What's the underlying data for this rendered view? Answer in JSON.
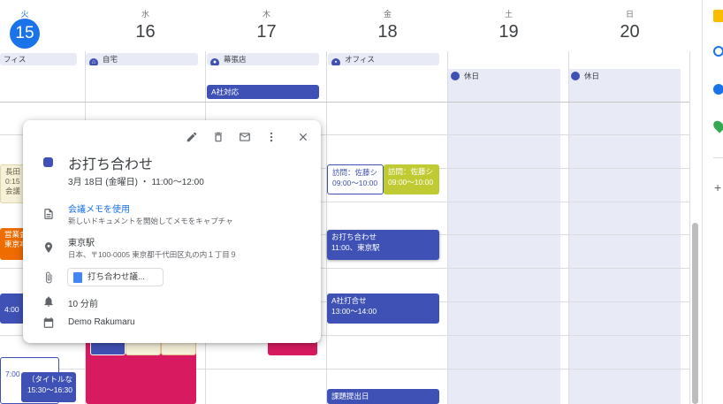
{
  "days": [
    {
      "dow": "火",
      "num": "15",
      "today": true
    },
    {
      "dow": "水",
      "num": "16"
    },
    {
      "dow": "木",
      "num": "17"
    },
    {
      "dow": "金",
      "num": "18"
    },
    {
      "dow": "土",
      "num": "19"
    },
    {
      "dow": "日",
      "num": "20"
    }
  ],
  "allday": {
    "tue": "フィス",
    "wed": "自宅",
    "thu": "幕張店",
    "fri": "オフィス",
    "thu_event": "A社対応",
    "sat": "休日",
    "sun": "休日"
  },
  "events": {
    "tue_a_line1": "長田",
    "tue_a_line2": "0:15",
    "tue_a_line3": "会議",
    "tue_b_line1": "営業会",
    "tue_b_line2": "東京本",
    "tue_c": "4:00",
    "tue_d": "7:00",
    "tue_e_line1": "（タイトルな",
    "tue_e_line2": "15:30〜16:30",
    "fri_visit1_title": "訪問：佐藤シ",
    "fri_visit1_time": "09:00〜10:00",
    "fri_visit2_title": "訪問：佐藤シ",
    "fri_visit2_time": "09:00〜10:00",
    "fri_meeting_title": "お打ち合わせ",
    "fri_meeting_sub": "11:00、東京駅",
    "fri_a_title": "A社打合せ",
    "fri_a_time": "13:00〜14:00",
    "fri_deadline_title": "課題提出日"
  },
  "popup": {
    "title": "お打ち合わせ",
    "datetime": "3月 18日 (金曜日) ・ 11:00〜12:00",
    "meet_link": "会議メモを使用",
    "meet_desc": "新しいドキュメントを開始してメモをキャプチャ",
    "location": "東京駅",
    "address": "日本、〒100-0005 東京都千代田区丸の内１丁目９",
    "attachment": "打ち合わせ議...",
    "reminder": "10 分前",
    "calendar": "Demo Rakumaru",
    "color": "#3f51b5"
  },
  "colors": {
    "accent": "#1a73e8",
    "event_blue": "#3f51b5",
    "event_olive": "#c0ca33",
    "event_orange": "#ef6c00",
    "event_pink": "#d81b60",
    "event_pale": "#f6f1d9"
  }
}
